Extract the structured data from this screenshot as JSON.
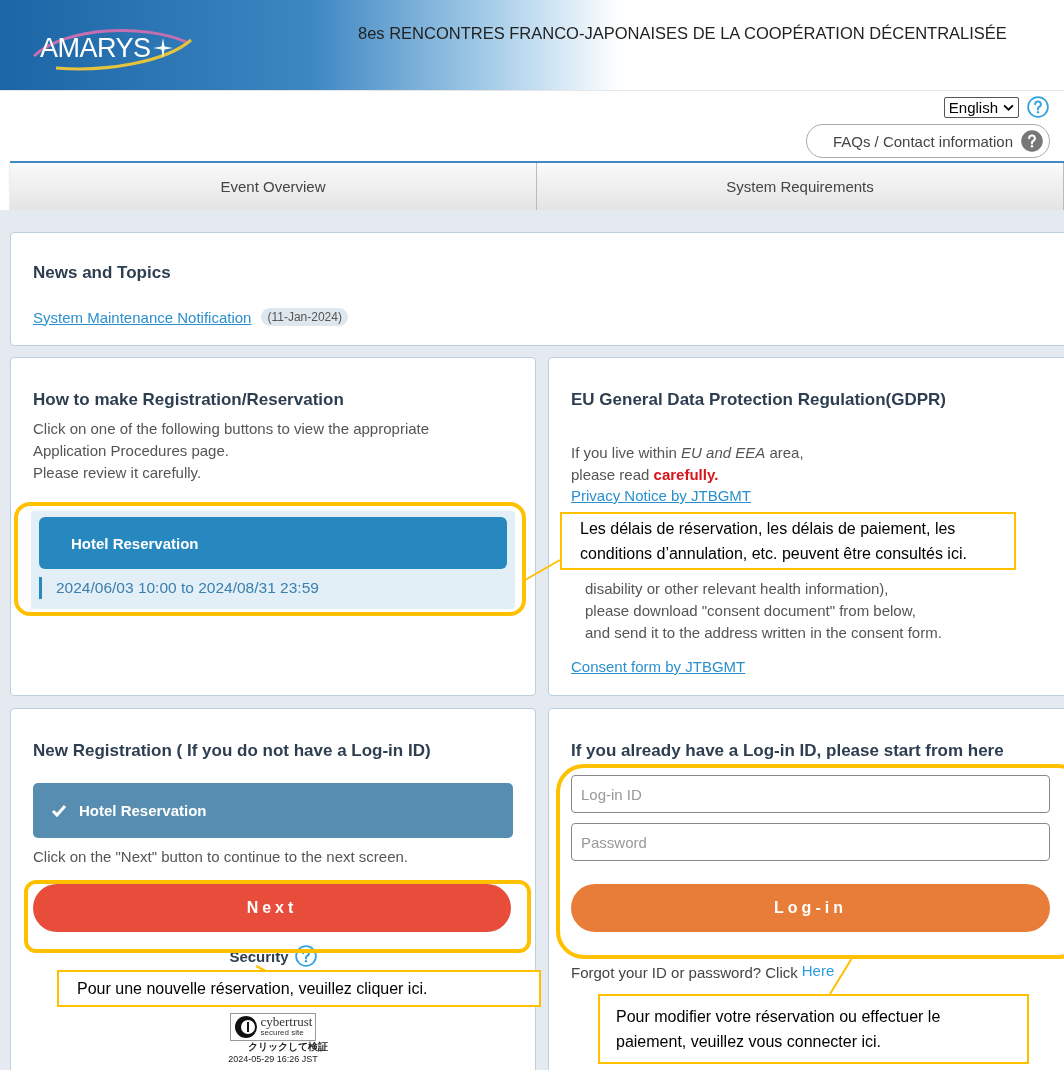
{
  "header": {
    "logo": "AMARYS",
    "title": "8es RENCONTRES FRANCO-JAPONAISES DE LA COOPÉRATION DÉCENTRALISÉE"
  },
  "language": {
    "value": "English"
  },
  "faq_button": "FAQs / Contact information",
  "tabs": [
    {
      "label": "Event Overview",
      "selected": false
    },
    {
      "label": "System Requirements",
      "selected": false
    }
  ],
  "news": {
    "title": "News and Topics",
    "items": [
      {
        "link": "System Maintenance Notification",
        "date": "(11-Jan-2024)"
      }
    ]
  },
  "how_to": {
    "title": "How to make Registration/Reservation",
    "text": [
      "Click on one of the following buttons to view the appropriate Application Procedures page.",
      "Please review it carefully."
    ],
    "button": "Hotel Reservation",
    "period": "2024/06/03 10:00 to 2024/08/31 23:59"
  },
  "gdpr": {
    "title": "EU General Data Protection Regulation(GDPR)",
    "intro": [
      "If you live within *EU and EEA* area,",
      "please read **carefully.**"
    ],
    "privacy_link": "Privacy Notice by JTBGMT",
    "notes": [
      "disability or other relevant health information),",
      "please download \"consent document\" from below,",
      "and send it to the address written in the consent form."
    ],
    "consent_link": "Consent form by JTBGMT"
  },
  "new_registration": {
    "title": "New Registration ( If you do not have a Log-in ID)",
    "options": [
      {
        "label": "Hotel Reservation",
        "checked": true
      }
    ],
    "hint": "Click on the \"Next\" button to continue to the next screen.",
    "next_button": "Next",
    "security": "Security",
    "seal": {
      "brand": "cybertrust",
      "sub": "secured site",
      "verify": "クリックして検証",
      "stamp": "2024-05-29 16:26 JST"
    }
  },
  "login": {
    "title": "If you already have a Log-in ID, please start from here",
    "fields": [
      {
        "placeholder": "Log-in ID"
      },
      {
        "placeholder": "Password"
      }
    ],
    "button": "Log-in",
    "forgot": "Forgot your ID or password? Click",
    "forgot_link": "Here"
  },
  "annotations": [
    {
      "text": "Les délais de réservation, les délais de paiement, les conditions d’annulation, etc. peuvent être consultés ici."
    },
    {
      "text": "Pour une nouvelle réservation, veuillez cliquer ici."
    },
    {
      "text": "Pour modifier votre réservation ou effectuer le paiement, veuillez vous connecter ici."
    }
  ]
}
